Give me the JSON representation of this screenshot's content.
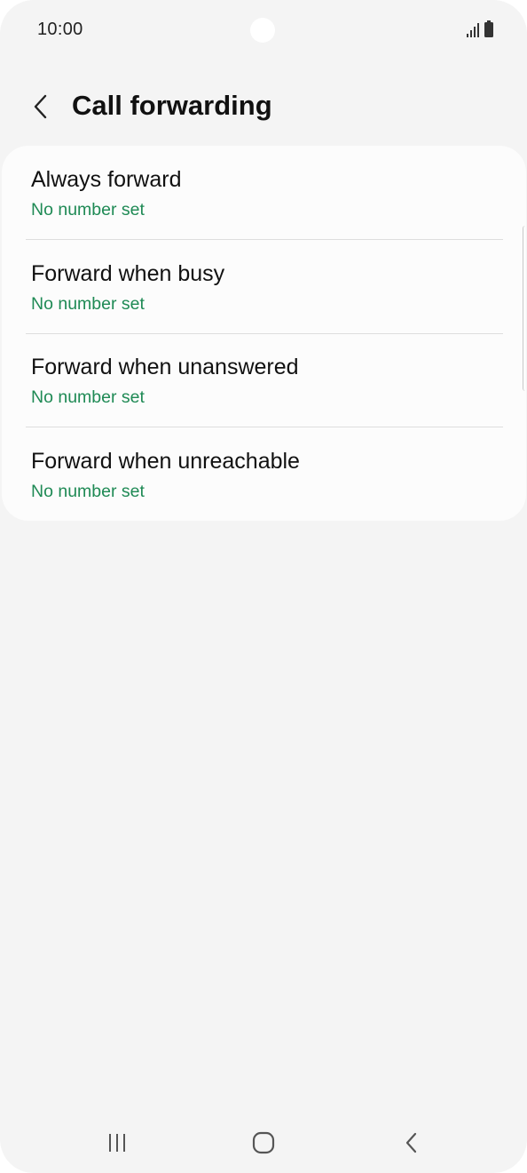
{
  "status_bar": {
    "time": "10:00",
    "icons": [
      "signal-icon",
      "battery-icon"
    ]
  },
  "header": {
    "title": "Call forwarding",
    "back_icon": "chevron-left-icon"
  },
  "forwarding_options": [
    {
      "title": "Always forward",
      "subtitle": "No number set"
    },
    {
      "title": "Forward when busy",
      "subtitle": "No number set"
    },
    {
      "title": "Forward when unanswered",
      "subtitle": "No number set"
    },
    {
      "title": "Forward when unreachable",
      "subtitle": "No number set"
    }
  ],
  "navigation_bar": {
    "buttons": [
      "recent-apps-icon",
      "home-icon",
      "back-icon"
    ]
  },
  "colors": {
    "background": "#f4f4f4",
    "card": "#fcfcfc",
    "accent_green": "#1f8a55",
    "text": "#111111"
  }
}
